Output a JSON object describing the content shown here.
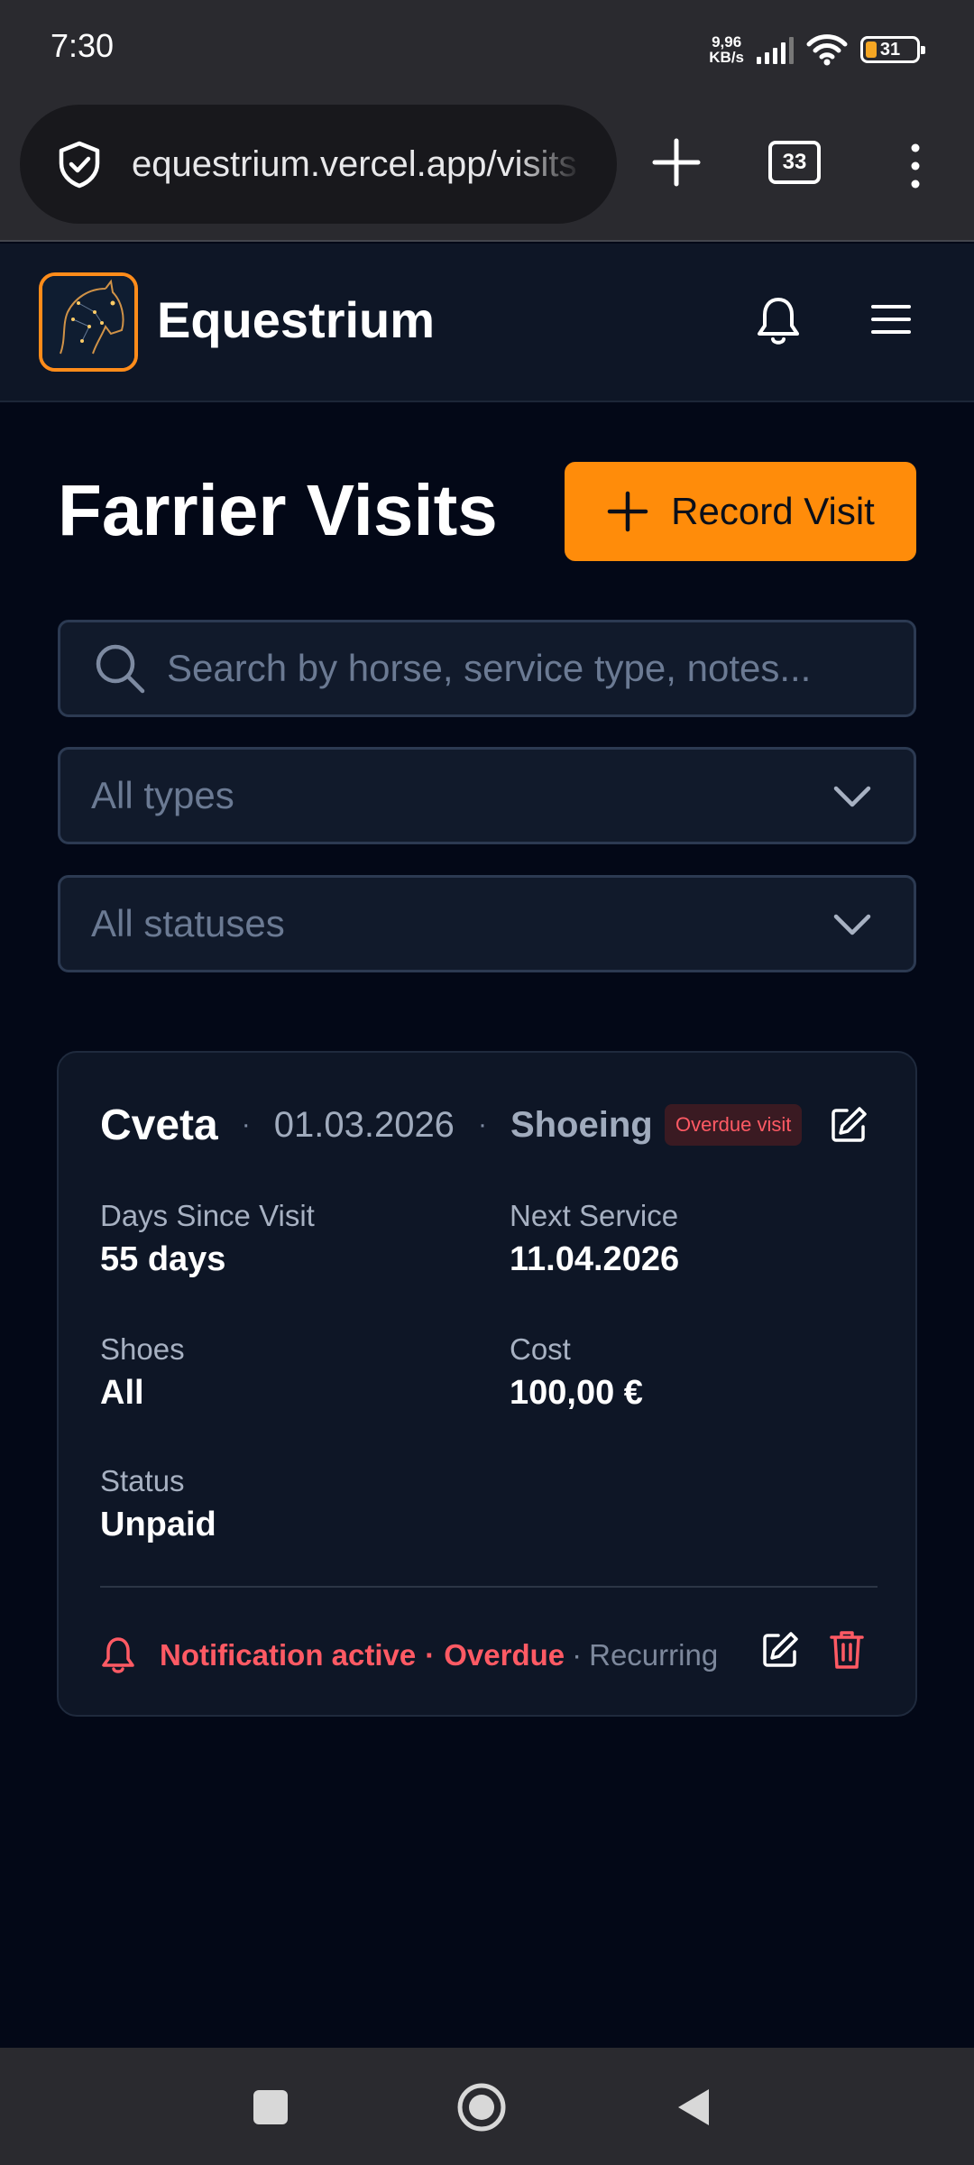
{
  "status_bar": {
    "time": "7:30",
    "net_speed_value": "9,96",
    "net_speed_unit": "KB/s",
    "battery": "31"
  },
  "browser": {
    "url": "equestrium.vercel.app/visits",
    "tab_count": "33"
  },
  "header": {
    "brand": "Equestrium",
    "logo_icon": "horse-head-icon"
  },
  "page": {
    "title": "Farrier Visits",
    "record_button": "Record Visit",
    "search_placeholder": "Search by horse, service type, notes...",
    "type_filter": "All types",
    "status_filter": "All statuses"
  },
  "visit_card": {
    "horse": "Cveta",
    "date": "01.03.2026",
    "type": "Shoeing",
    "badge": "Overdue visit",
    "fields": {
      "days_since_label": "Days Since Visit",
      "days_since_value": "55 days",
      "next_service_label": "Next Service",
      "next_service_value": "11.04.2026",
      "shoes_label": "Shoes",
      "shoes_value": "All",
      "cost_label": "Cost",
      "cost_value": "100,00 €",
      "status_label": "Status",
      "status_value": "Unpaid"
    },
    "footer": {
      "notification": "Notification active",
      "overdue": "Overdue",
      "recurring": "Recurring"
    }
  },
  "colors": {
    "accent": "#ff8c0a",
    "danger": "#ff5a64",
    "background": "#030817",
    "card": "#0e1626"
  }
}
